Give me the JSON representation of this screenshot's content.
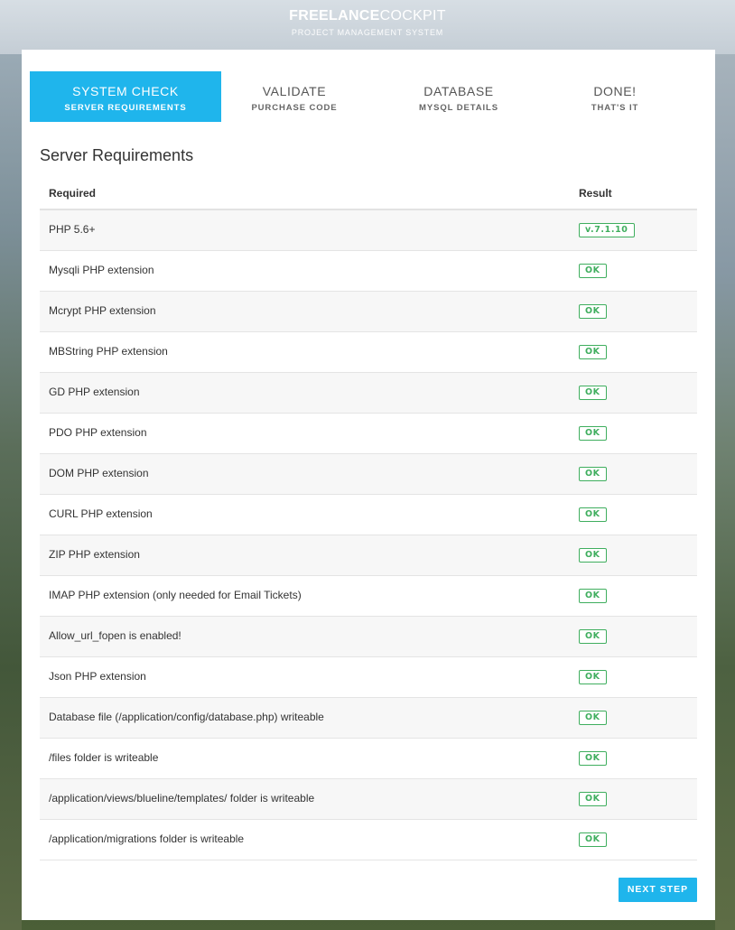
{
  "brand": {
    "title_bold": "FREELANCE",
    "title_light": "COCKPIT",
    "subtitle": "PROJECT MANAGEMENT SYSTEM"
  },
  "steps": [
    {
      "title": "SYSTEM CHECK",
      "subtitle": "SERVER REQUIREMENTS",
      "active": true
    },
    {
      "title": "VALIDATE",
      "subtitle": "PURCHASE CODE",
      "active": false
    },
    {
      "title": "DATABASE",
      "subtitle": "MYSQL DETAILS",
      "active": false
    },
    {
      "title": "DONE!",
      "subtitle": "THAT'S IT",
      "active": false
    }
  ],
  "section_title": "Server Requirements",
  "table": {
    "headers": {
      "required": "Required",
      "result": "Result"
    },
    "rows": [
      {
        "label": "PHP 5.6+",
        "result": "v.7.1.10"
      },
      {
        "label": "Mysqli PHP extension",
        "result": "OK"
      },
      {
        "label": "Mcrypt PHP extension",
        "result": "OK"
      },
      {
        "label": "MBString PHP extension",
        "result": "OK"
      },
      {
        "label": "GD PHP extension",
        "result": "OK"
      },
      {
        "label": "PDO PHP extension",
        "result": "OK"
      },
      {
        "label": "DOM PHP extension",
        "result": "OK"
      },
      {
        "label": "CURL PHP extension",
        "result": "OK"
      },
      {
        "label": "ZIP PHP extension",
        "result": "OK"
      },
      {
        "label": "IMAP PHP extension (only needed for Email Tickets)",
        "result": "OK"
      },
      {
        "label": "Allow_url_fopen is enabled!",
        "result": "OK"
      },
      {
        "label": "Json PHP extension",
        "result": "OK"
      },
      {
        "label": "Database file (/application/config/database.php) writeable",
        "result": "OK"
      },
      {
        "label": "/files folder is writeable",
        "result": "OK"
      },
      {
        "label": "/application/views/blueline/templates/ folder is writeable",
        "result": "OK"
      },
      {
        "label": "/application/migrations folder is writeable",
        "result": "OK"
      }
    ]
  },
  "next_button": "NEXT STEP",
  "colors": {
    "accent": "#1fb5ec",
    "ok_green": "#3fae5e"
  }
}
